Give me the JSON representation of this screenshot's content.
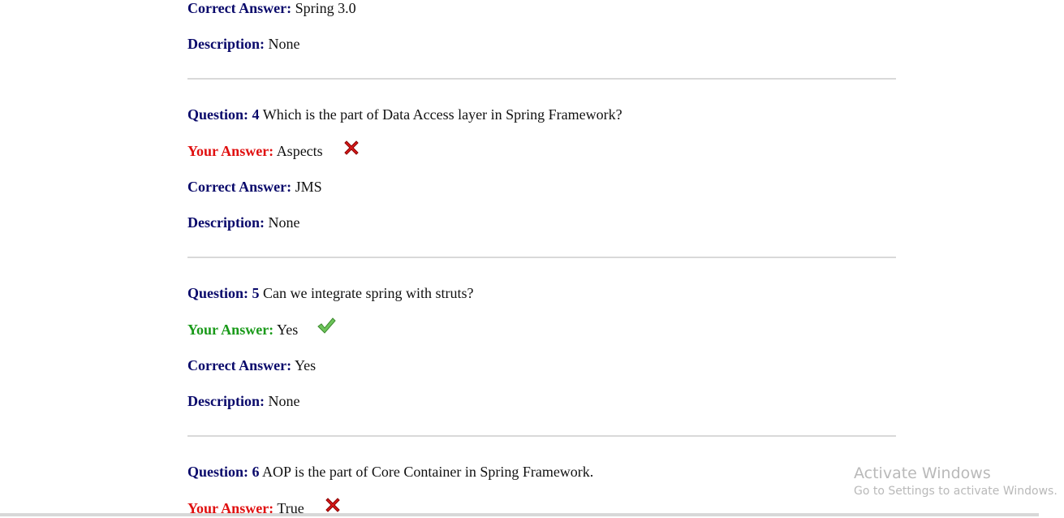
{
  "labels": {
    "question": "Question:",
    "your_answer": "Your Answer:",
    "correct_answer": "Correct Answer:",
    "description": "Description:"
  },
  "prev": {
    "correct_answer": "Spring 3.0",
    "description": "None"
  },
  "q4": {
    "number": "4",
    "text": "Which is the part of Data Access layer in Spring Framework?",
    "your_answer": "Aspects",
    "status": "incorrect",
    "correct_answer": "JMS",
    "description": "None"
  },
  "q5": {
    "number": "5",
    "text": "Can we integrate spring with struts?",
    "your_answer": "Yes",
    "status": "correct",
    "correct_answer": "Yes",
    "description": "None"
  },
  "q6": {
    "number": "6",
    "text": "AOP is the part of Core Container in Spring Framework.",
    "your_answer": "True",
    "status": "incorrect"
  },
  "watermark": {
    "title": "Activate Windows",
    "subtitle": "Go to Settings to activate Windows."
  },
  "colors": {
    "label_blue": "#0a0a6b",
    "wrong_red": "#e01010",
    "right_green": "#1a9a1a"
  }
}
